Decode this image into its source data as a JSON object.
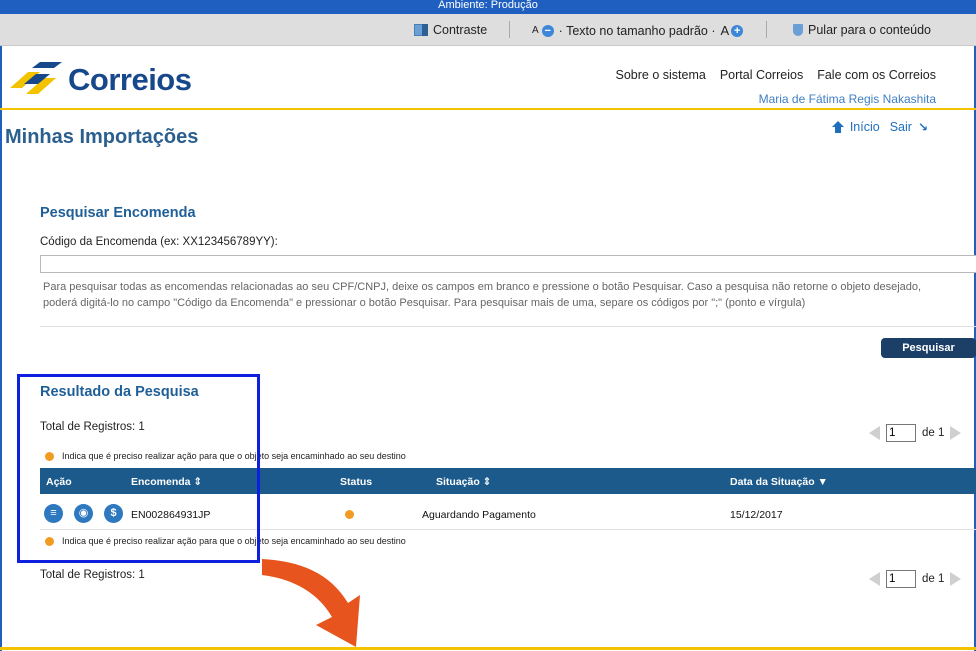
{
  "environment_banner": "Ambiente: Produção",
  "accessibility": {
    "contrast_label": "Contraste",
    "font_decrease": "A",
    "font_size_label": "· Texto no tamanho padrão ·",
    "font_increase": "A",
    "skip_label": "Pular para o conteúdo"
  },
  "header": {
    "logo_text": "Correios",
    "links": [
      "Sobre o sistema",
      "Portal Correios",
      "Fale com os Correios"
    ],
    "user_name": "Maria de Fátima Regis Nakashita"
  },
  "page": {
    "title": "Minhas Importações",
    "home_link": "Início",
    "logout_link": "Sair"
  },
  "search": {
    "title": "Pesquisar Encomenda",
    "field_label": "Código da Encomenda (ex: XX123456789YY):",
    "input_value": "",
    "help_line1": "Para pesquisar todas as encomendas relacionadas ao seu CPF/CNPJ, deixe os campos em branco e pressione o botão Pesquisar. Caso a pesquisa não retorne o objeto desejado,",
    "help_line2": "poderá digitá-lo no campo \"Código da Encomenda\" e pressionar o botão Pesquisar. Para pesquisar mais de uma, separe os códigos por \";\" (ponto e vírgula)",
    "button_label": "Pesquisar"
  },
  "results": {
    "title": "Resultado da Pesquisa",
    "total_label": "Total de Registros: 1",
    "legend_text": "Indica que é preciso realizar ação para que o objeto seja encaminhado ao seu destino",
    "pager": {
      "current_page": "1",
      "of_label": "de 1"
    },
    "columns": {
      "action": "Ação",
      "tracking": "Encomenda ⇕",
      "status": "Status",
      "situation": "Situação ⇕",
      "date": "Data da Situação ▼"
    },
    "rows": [
      {
        "tracking": "EN002864931JP",
        "situation": "Aguardando Pagamento",
        "date": "15/12/2017",
        "status_color": "#f29b22"
      }
    ]
  },
  "colors": {
    "brand_blue": "#18488c",
    "brand_yellow": "#f3c300",
    "table_header": "#1b5a8b",
    "status_orange": "#f29b22",
    "highlight_box": "#0f1fe0",
    "annotation_arrow": "#e8541e"
  },
  "icons": [
    "contrast-icon",
    "minus-icon",
    "plus-icon",
    "shield-icon",
    "home-icon",
    "exit-icon",
    "list-icon",
    "eye-icon",
    "dollar-icon",
    "arrow-down-icon"
  ]
}
